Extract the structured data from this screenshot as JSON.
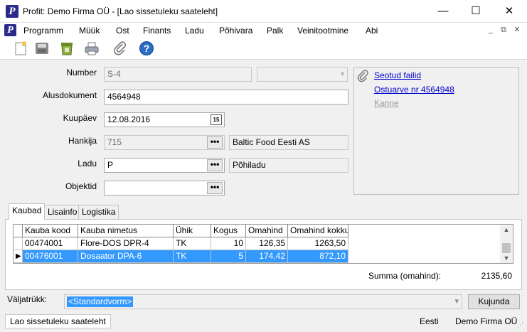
{
  "window": {
    "title": "Profit: Demo Firma OÜ - [Lao sissetuleku saateleht]",
    "minimize_glyph": "—",
    "maximize_glyph": "☐",
    "close_glyph": "✕"
  },
  "app_icon_letter": "P",
  "menu": {
    "items": [
      "Programm",
      "Müük",
      "Ost",
      "Finants",
      "Ladu",
      "Põhivara",
      "Palk",
      "Veinitootmine",
      "Abi"
    ]
  },
  "toolbar": {
    "icons": [
      "new-document-icon",
      "save-icon",
      "delete-icon",
      "print-icon",
      "attach-icon",
      "help-icon"
    ]
  },
  "form": {
    "number_label": "Number",
    "number_value": "S-4",
    "alusdokument_label": "Alusdokument",
    "alusdokument_value": "4564948",
    "kuupaev_label": "Kuupäev",
    "kuupaev_value": "12.08.2016",
    "calendar_glyph": "15",
    "hankija_label": "Hankija",
    "hankija_value": "715",
    "hankija_name": "Baltic Food Eesti AS",
    "ladu_label": "Ladu",
    "ladu_value": "P",
    "ladu_name": "Põhiladu",
    "objektid_label": "Objektid",
    "objektid_value": "",
    "lookup_glyph": "•••"
  },
  "related": {
    "links": [
      "Seotud failid",
      "Ostuarve nr 4564948"
    ],
    "disabled_link": "Kanne"
  },
  "tabs": [
    "Kaubad",
    "Lisainfo",
    "Logistika"
  ],
  "grid": {
    "columns": [
      "Kauba kood",
      "Kauba nimetus",
      "Ühik",
      "Kogus",
      "Omahind",
      "Omahind kokku"
    ],
    "rows": [
      [
        "00474001",
        "Flore-DOS DPR-4",
        "TK",
        "10",
        "126,35",
        "1263,50"
      ],
      [
        "00476001",
        "Dosaator DPA-6",
        "TK",
        "5",
        "174,42",
        "872,10"
      ]
    ]
  },
  "summa": {
    "label": "Summa (omahind):",
    "value": "2135,60"
  },
  "valjatrukk": {
    "label": "Väljatrükk:",
    "value": "<Standardvorm>",
    "button": "Kujunda"
  },
  "status": {
    "document": "Lao sissetuleku saateleht",
    "language": "Eesti",
    "company": "Demo Firma OÜ"
  },
  "colors": {
    "selection": "#3399ff",
    "link": "#0000cc",
    "app_icon": "#2a2a8c"
  }
}
